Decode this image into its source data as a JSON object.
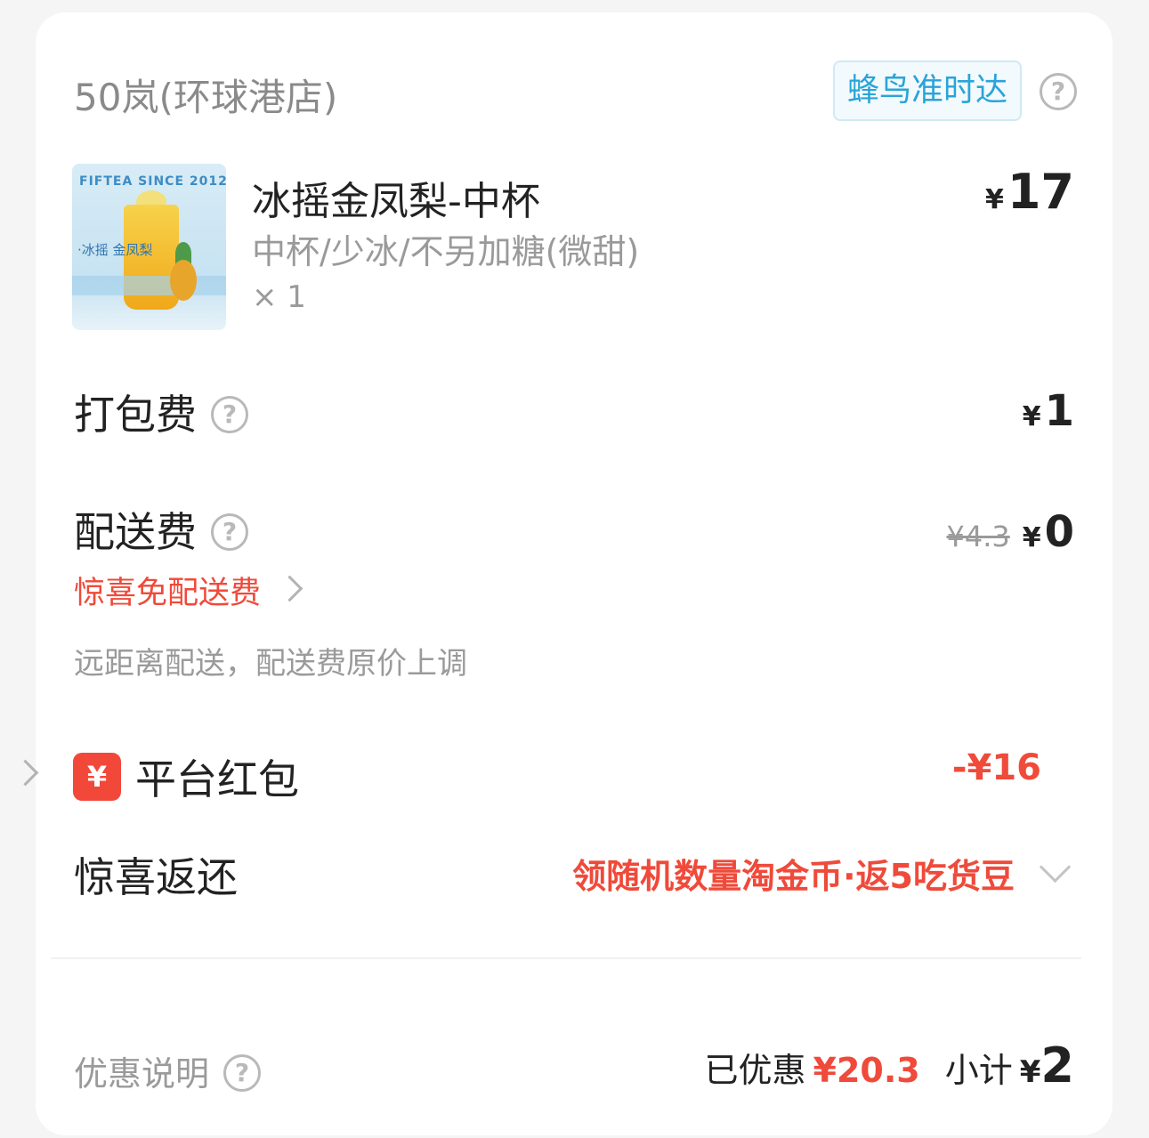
{
  "store": {
    "name": "50岚(环球港店)",
    "delivery_badge": "蜂鸟准时达",
    "help_icon": "question-circle-icon"
  },
  "product": {
    "image_text": "FIFTEA SINCE 2012",
    "image_tag": "·冰摇 金凤梨",
    "name": "冰摇金凤梨-中杯",
    "spec": "中杯/少冰/不另加糖(微甜)",
    "quantity": "× 1",
    "price_symbol": "¥",
    "price": "17"
  },
  "packing": {
    "label": "打包费",
    "price_symbol": "¥",
    "price": "1"
  },
  "delivery": {
    "label": "配送费",
    "original_price": "¥4.3",
    "price_symbol": "¥",
    "price": "0",
    "promo_link": "惊喜免配送费",
    "note": "远距离配送，配送费原价上调"
  },
  "red_packet": {
    "icon_text": "¥",
    "label": "平台红包",
    "value": "-¥16"
  },
  "surprise_return": {
    "label": "惊喜返还",
    "value": "领随机数量淘金币·返5吃货豆"
  },
  "footer": {
    "discount_label": "优惠说明",
    "saved_label": "已优惠",
    "saved_value": "¥20.3",
    "subtotal_label": "小计",
    "subtotal_symbol": "¥",
    "subtotal_value": "2"
  },
  "colors": {
    "accent_red": "#ef4a3a",
    "badge_blue": "#2aa4d9",
    "muted": "#9a9a9a"
  }
}
